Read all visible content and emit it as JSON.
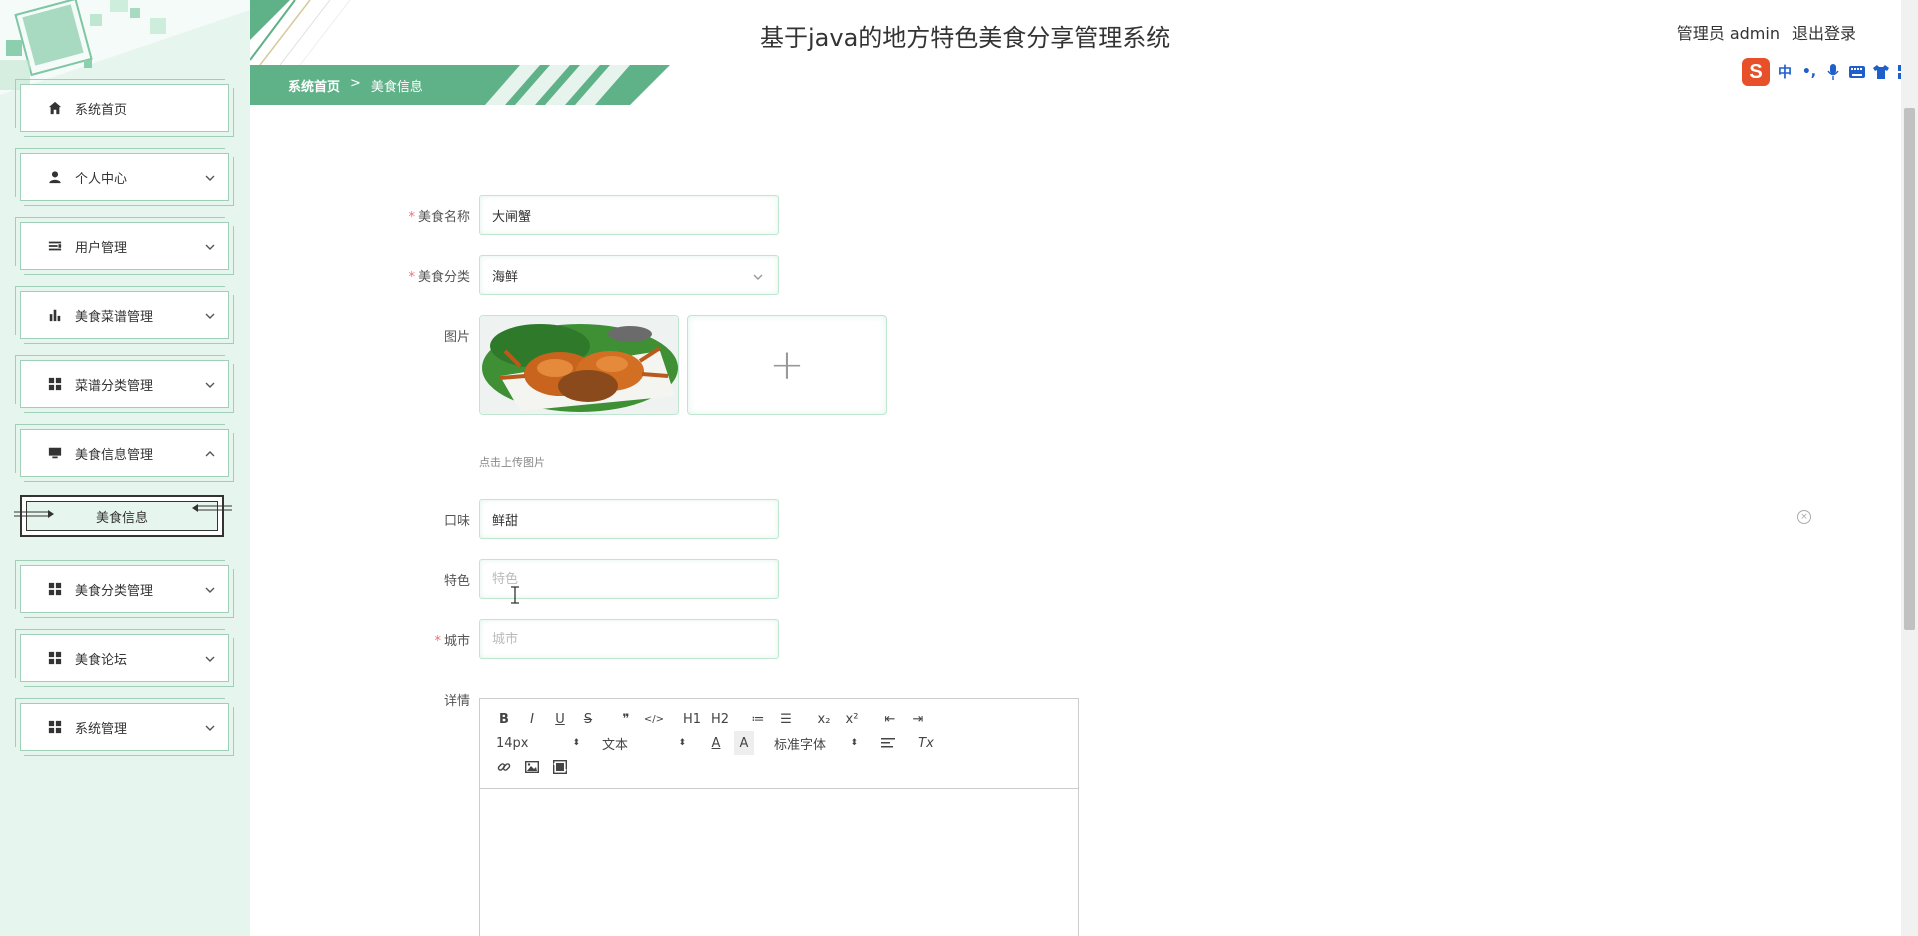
{
  "app": {
    "title": "基于java的地方特色美食分享管理系统",
    "user_label": "管理员 admin",
    "logout": "退出登录"
  },
  "breadcrumb": {
    "home": "系统首页",
    "separator": ">",
    "current": "美食信息"
  },
  "ime": {
    "logo": "S",
    "mode": "中",
    "punct": "•,"
  },
  "sidebar": {
    "items": [
      {
        "label": "系统首页",
        "icon": "home-icon"
      },
      {
        "label": "个人中心",
        "icon": "user-icon"
      },
      {
        "label": "用户管理",
        "icon": "list-icon"
      },
      {
        "label": "美食菜谱管理",
        "icon": "bar-chart-icon"
      },
      {
        "label": "菜谱分类管理",
        "icon": "grid-icon"
      },
      {
        "label": "美食信息管理",
        "icon": "monitor-icon"
      },
      {
        "label": "美食分类管理",
        "icon": "grid-icon"
      },
      {
        "label": "美食论坛",
        "icon": "grid-icon"
      },
      {
        "label": "系统管理",
        "icon": "grid-icon"
      }
    ],
    "sub_item": "美食信息"
  },
  "form": {
    "name": {
      "label": "美食名称",
      "value": "大闸蟹"
    },
    "category": {
      "label": "美食分类",
      "value": "海鲜"
    },
    "image": {
      "label": "图片",
      "tip": "点击上传图片",
      "add": "+"
    },
    "taste": {
      "label": "口味",
      "value": "鲜甜"
    },
    "feature": {
      "label": "特色",
      "value": "",
      "placeholder": "特色"
    },
    "city": {
      "label": "城市",
      "value": "",
      "placeholder": "城市"
    },
    "detail": {
      "label": "详情"
    },
    "required_mark": "*",
    "clear_icon": "×"
  },
  "editor": {
    "font_size": "14px",
    "block_type": "文本",
    "font_family": "标准字体",
    "buttons_row1": [
      "B",
      "I",
      "U",
      "S",
      "❞",
      "</>",
      "H1",
      "H2",
      "≔",
      "☰",
      "x₂",
      "x²",
      "⇤",
      "⇥"
    ],
    "select_arrow": "⬍",
    "color_btn": "A",
    "bg_btn": "A",
    "clean_btn": "Tx"
  },
  "colors": {
    "accent": "#5fb188",
    "sidebar_bg": "#e6f5ee",
    "border": "#bfe6d0",
    "required": "#f56c6c"
  }
}
